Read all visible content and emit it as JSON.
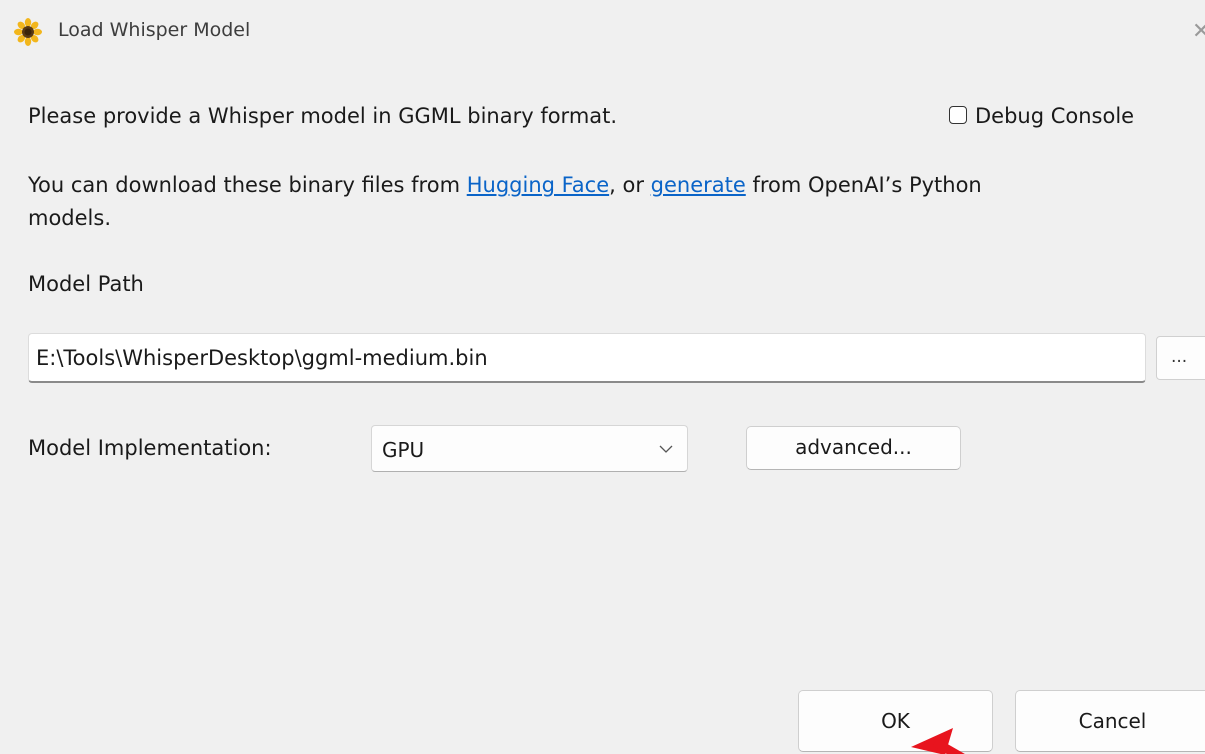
{
  "window": {
    "title": "Load Whisper Model",
    "close_glyph": "✕"
  },
  "intro": {
    "text": "Please provide a Whisper model in GGML binary format."
  },
  "debug_console": {
    "label": "Debug Console",
    "checked": false
  },
  "download": {
    "prefix": "You can download these binary files from ",
    "link1": "Hugging Face",
    "middle": ", or ",
    "link2": "generate",
    "suffix": " from OpenAI’s Python",
    "line2": "models."
  },
  "model_path": {
    "label": "Model Path",
    "value": "E:\\Tools\\WhisperDesktop\\ggml-medium.bin",
    "browse_label": "..."
  },
  "implementation": {
    "label": "Model Implementation:",
    "selected": "GPU",
    "advanced_label": "advanced..."
  },
  "footer": {
    "ok_label": "OK",
    "cancel_label": "Cancel"
  },
  "colors": {
    "background": "#f0f0f0",
    "link": "#0a64c8",
    "annotation_arrow": "#e8141e"
  },
  "icons": {
    "app": "sunflower-icon",
    "close": "close-icon",
    "dropdown": "chevron-down-icon"
  }
}
